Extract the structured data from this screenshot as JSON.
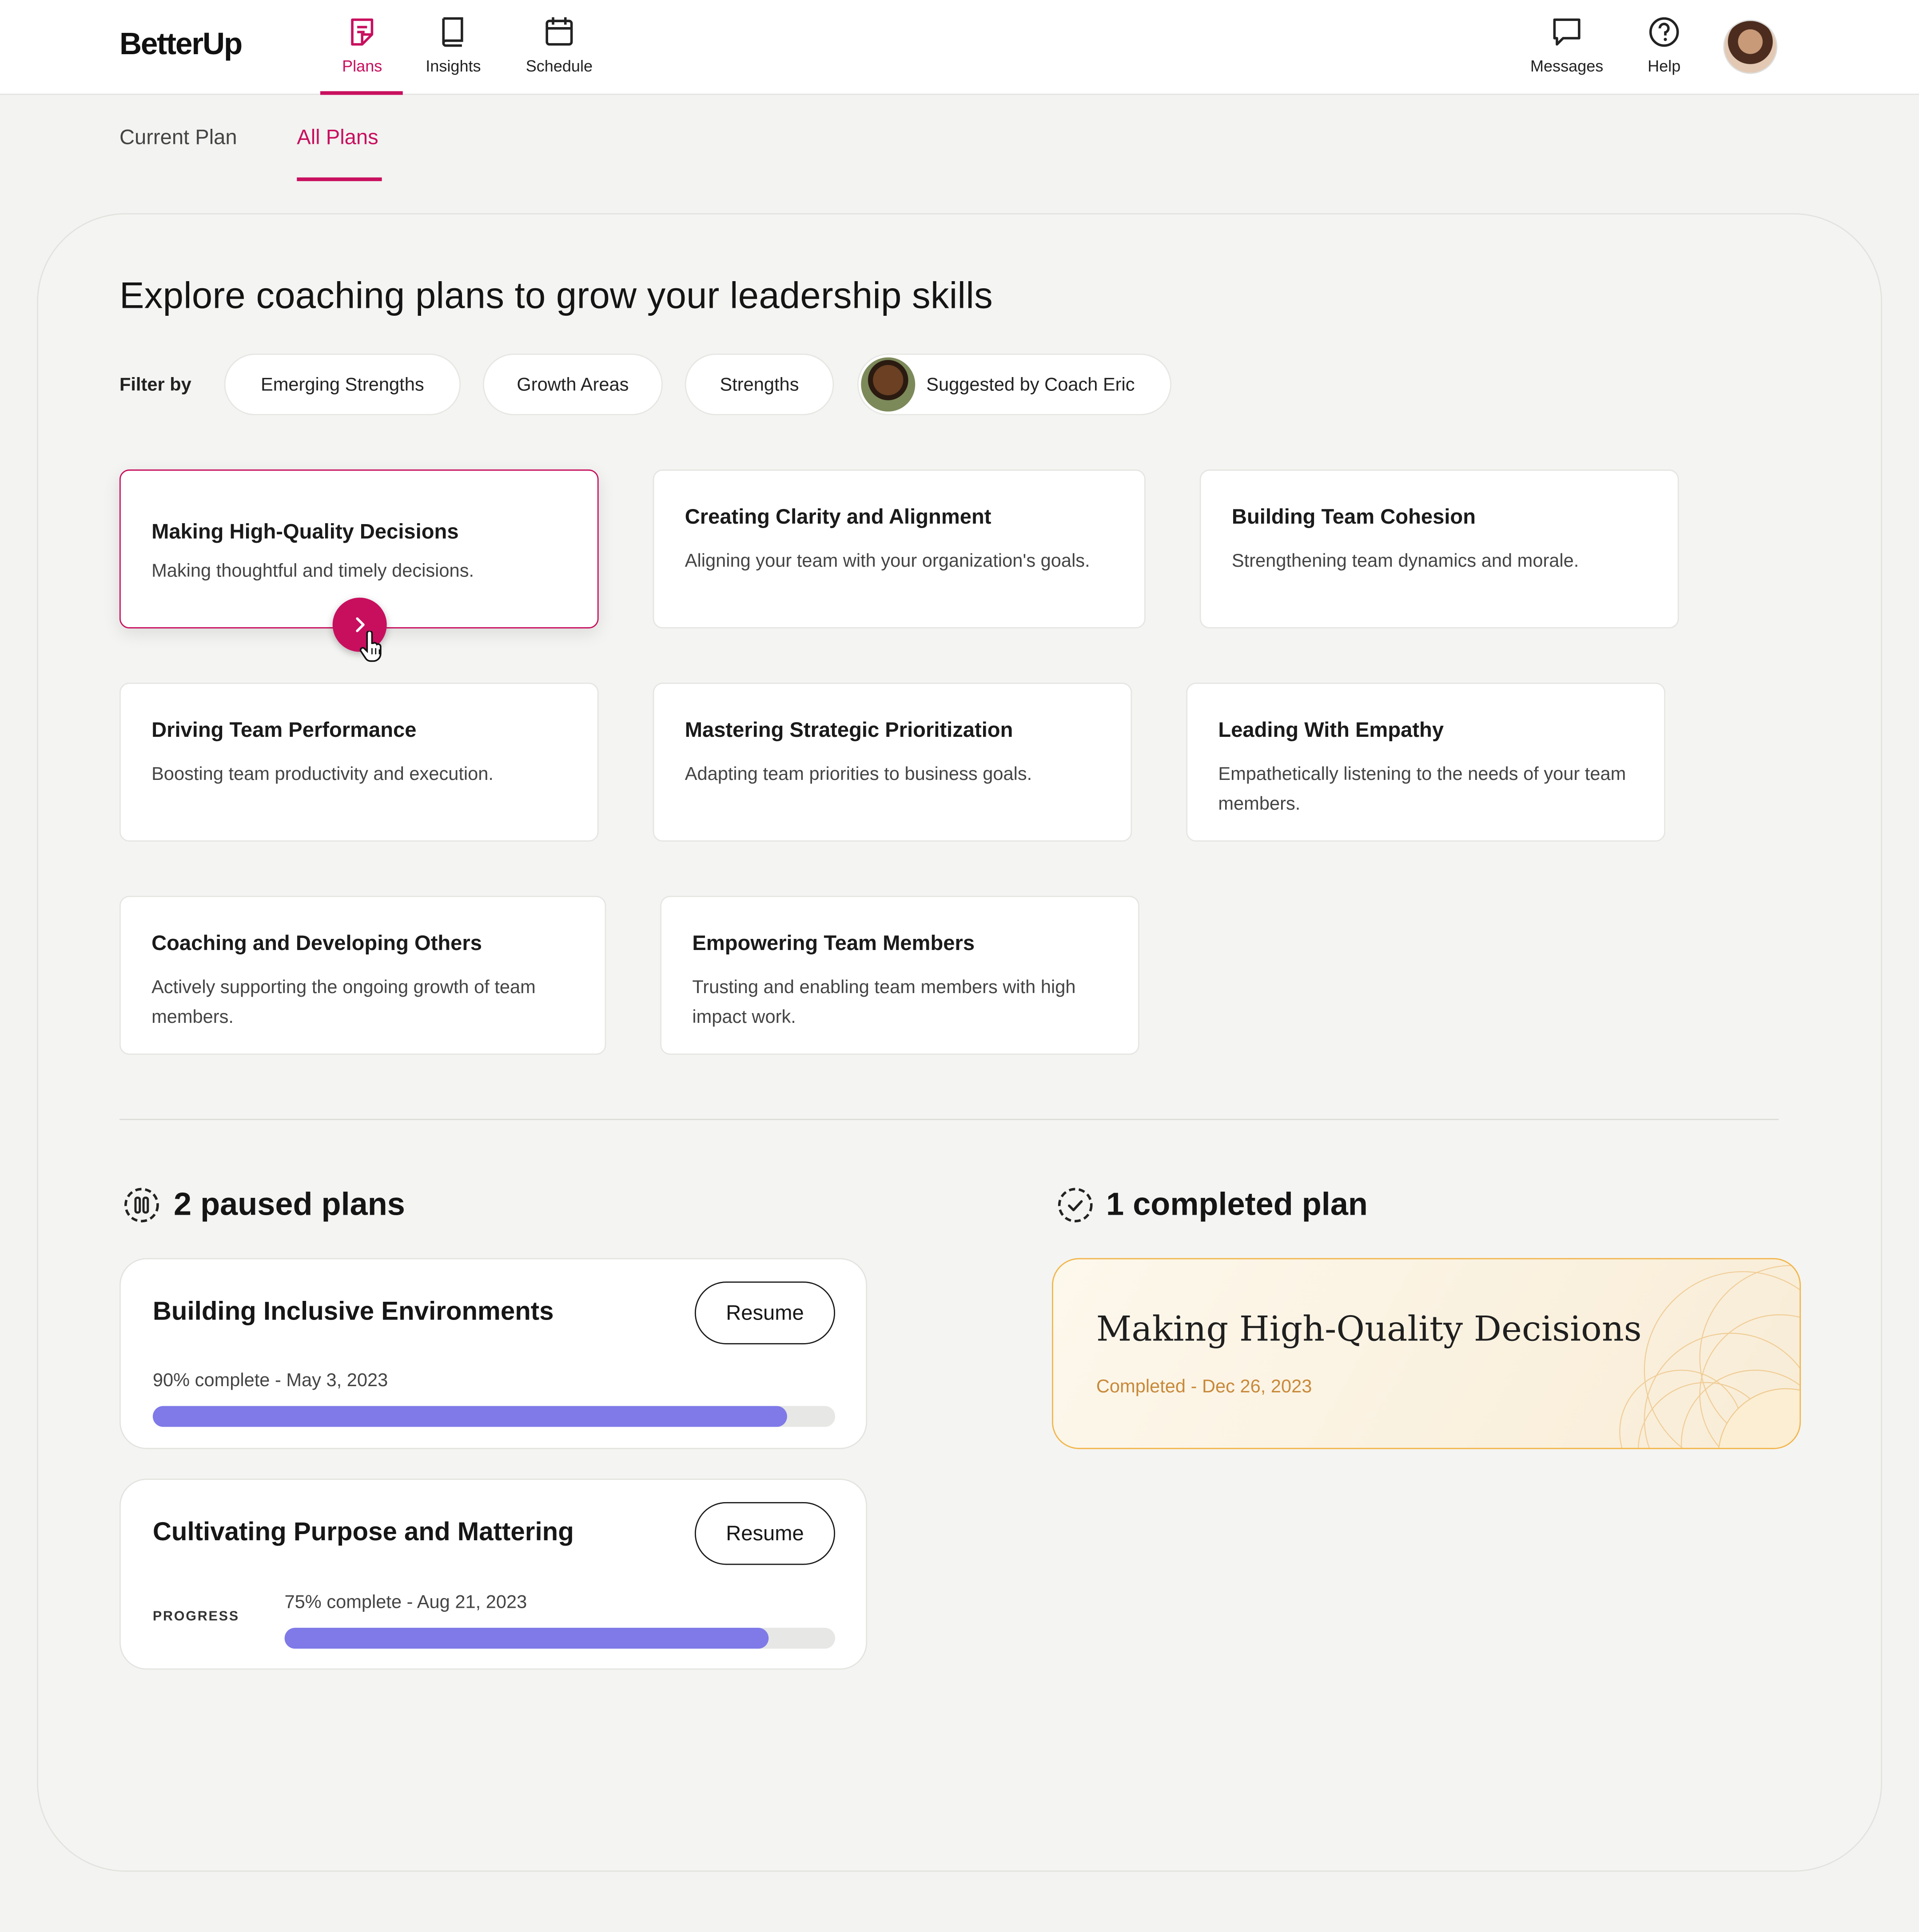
{
  "app": {
    "name": "BetterUp"
  },
  "nav": {
    "items": [
      {
        "label": "Plans",
        "icon": "plans-icon"
      },
      {
        "label": "Insights",
        "icon": "book-icon"
      },
      {
        "label": "Schedule",
        "icon": "calendar-icon"
      }
    ],
    "right": [
      {
        "label": "Messages",
        "icon": "chat-icon"
      },
      {
        "label": "Help",
        "icon": "help-icon"
      }
    ]
  },
  "subtabs": {
    "current": "Current Plan",
    "all": "All Plans"
  },
  "explore": {
    "heading": "Explore coaching plans to grow your leadership skills",
    "filter_label": "Filter by",
    "filters": [
      "Emerging Strengths",
      "Growth Areas",
      "Strengths",
      "Suggested by Coach Eric"
    ]
  },
  "plans": [
    {
      "title": "Making High-Quality Decisions",
      "desc": "Making thoughtful and timely decisions."
    },
    {
      "title": "Creating Clarity and Alignment",
      "desc": "Aligning your team with your organization's goals."
    },
    {
      "title": "Building Team Cohesion",
      "desc": "Strengthening team dynamics and morale."
    },
    {
      "title": "Driving Team Performance",
      "desc": "Boosting team productivity and execution."
    },
    {
      "title": "Mastering Strategic Prioritization",
      "desc": "Adapting team priorities to business goals."
    },
    {
      "title": "Leading With Empathy",
      "desc": "Empathetically listening to the needs of your team members."
    },
    {
      "title": "Coaching and Developing Others",
      "desc": "Actively supporting the ongoing growth of team members."
    },
    {
      "title": "Empowering Team Members",
      "desc": "Trusting and enabling team members with high impact work."
    }
  ],
  "paused": {
    "title": "2 paused plans",
    "items": [
      {
        "title": "Building Inclusive Environments",
        "status": "90% complete - May 3, 2023",
        "progress": 0.93,
        "button": "Resume"
      },
      {
        "title": "Cultivating Purpose and Mattering",
        "label": "PROGRESS",
        "status": "75% complete - Aug 21, 2023",
        "progress": 0.88,
        "button": "Resume"
      }
    ]
  },
  "completed": {
    "title": "1 completed plan",
    "items": [
      {
        "title": "Making High-Quality Decisions",
        "status": "Completed - Dec 26, 2023"
      }
    ]
  },
  "colors": {
    "accent": "#c80f5e",
    "progress": "#7f7ae8",
    "completed_border": "#f2b54a",
    "completed_text": "#c8893a"
  }
}
